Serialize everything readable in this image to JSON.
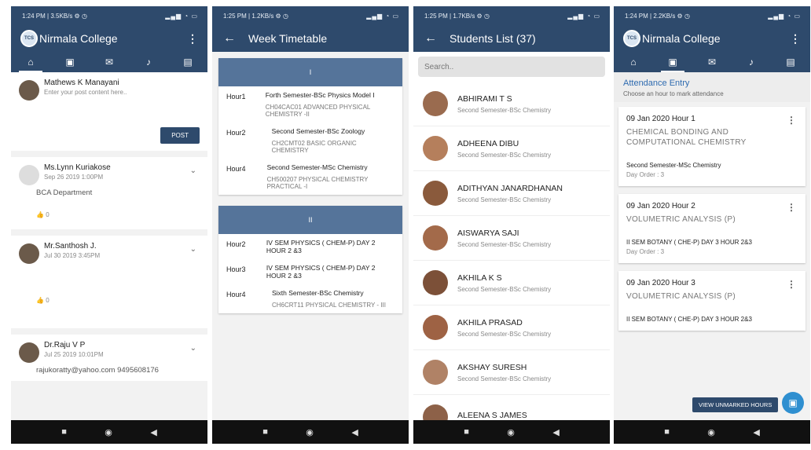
{
  "p1": {
    "status": "1:24 PM | 3.5KB/s ⚙ ◷",
    "title": "Nirmala College",
    "composer": {
      "name": "Mathews K Manayani",
      "placeholder": "Enter your post content here..",
      "post": "POST"
    },
    "posts": [
      {
        "name": "Ms.Lynn Kuriakose",
        "date": "Sep 26 2019 1:00PM",
        "body": "BCA Department",
        "likes": "0"
      },
      {
        "name": "Mr.Santhosh J.",
        "date": "Jul 30 2019 3:45PM",
        "body": "",
        "likes": "0"
      },
      {
        "name": "Dr.Raju V P",
        "date": "Jul 25 2019 10:01PM",
        "body": "rajukoratty@yahoo.com 9495608176",
        "likes": ""
      }
    ]
  },
  "p2": {
    "status": "1:25 PM | 1.2KB/s ⚙ ◷",
    "title": "Week Timetable",
    "days": [
      {
        "label": "I",
        "rows": [
          {
            "hour": "Hour1",
            "c1": "Forth Semester-BSc Physics Model I",
            "c2": "CH04CAC01 ADVANCED PHYSICAL CHEMISTRY -II"
          },
          {
            "hour": "Hour2",
            "c1": "Second Semester-BSc Zoology",
            "c2": "CH2CMT02 BASIC ORGANIC CHEMISTRY"
          },
          {
            "hour": "Hour4",
            "c1": "Second Semester-MSc Chemistry",
            "c2": "CH500207 PHYSICAL CHEMISTRY PRACTICAL -I"
          }
        ]
      },
      {
        "label": "II",
        "rows": [
          {
            "hour": "Hour2",
            "c1": "IV SEM PHYSICS ( CHEM-P) DAY 2 HOUR 2 &3",
            "c2": ""
          },
          {
            "hour": "Hour3",
            "c1": "IV SEM PHYSICS ( CHEM-P) DAY 2 HOUR 2 &3",
            "c2": ""
          },
          {
            "hour": "Hour4",
            "c1": "Sixth Semester-BSc Chemistry",
            "c2": "CH6CRT11 PHYSICAL CHEMISTRY - III"
          }
        ]
      }
    ]
  },
  "p3": {
    "status": "1:25 PM | 1.7KB/s ⚙ ◷",
    "title": "Students List (37)",
    "search": "Search..",
    "students": [
      {
        "n": "ABHIRAMI T S",
        "s": "Second Semester-BSc Chemistry"
      },
      {
        "n": "ADHEENA  DIBU",
        "s": "Second Semester-BSc Chemistry"
      },
      {
        "n": "ADITHYAN JANARDHANAN",
        "s": "Second Semester-BSc Chemistry"
      },
      {
        "n": "AISWARYA SAJI",
        "s": "Second Semester-BSc Chemistry"
      },
      {
        "n": "AKHILA K S",
        "s": "Second Semester-BSc Chemistry"
      },
      {
        "n": "AKHILA PRASAD",
        "s": "Second Semester-BSc Chemistry"
      },
      {
        "n": "AKSHAY SURESH",
        "s": "Second Semester-BSc Chemistry"
      },
      {
        "n": "ALEENA S JAMES",
        "s": ""
      }
    ]
  },
  "p4": {
    "status": "1:24 PM | 2.2KB/s ⚙ ◷",
    "title": "Nirmala College",
    "heading": "Attendance Entry",
    "sub": "Choose an hour to mark attendance",
    "cards": [
      {
        "h": "09 Jan 2020   Hour 1",
        "sub": "CHEMICAL BONDING AND COMPUTATIONAL CHEMISTRY",
        "sem": "Second Semester-MSc Chemistry",
        "do": "Day Order : 3"
      },
      {
        "h": "09 Jan 2020   Hour 2",
        "sub": "VOLUMETRIC ANALYSIS (P)",
        "sem": "II SEM BOTANY ( CHE-P) DAY 3 HOUR 2&3",
        "do": "Day Order : 3"
      },
      {
        "h": "09 Jan 2020   Hour 3",
        "sub": "VOLUMETRIC ANALYSIS (P)",
        "sem": "II SEM BOTANY ( CHE-P) DAY 3 HOUR 2&3",
        "do": ""
      }
    ],
    "vu": "VIEW UNMARKED HOURS"
  }
}
